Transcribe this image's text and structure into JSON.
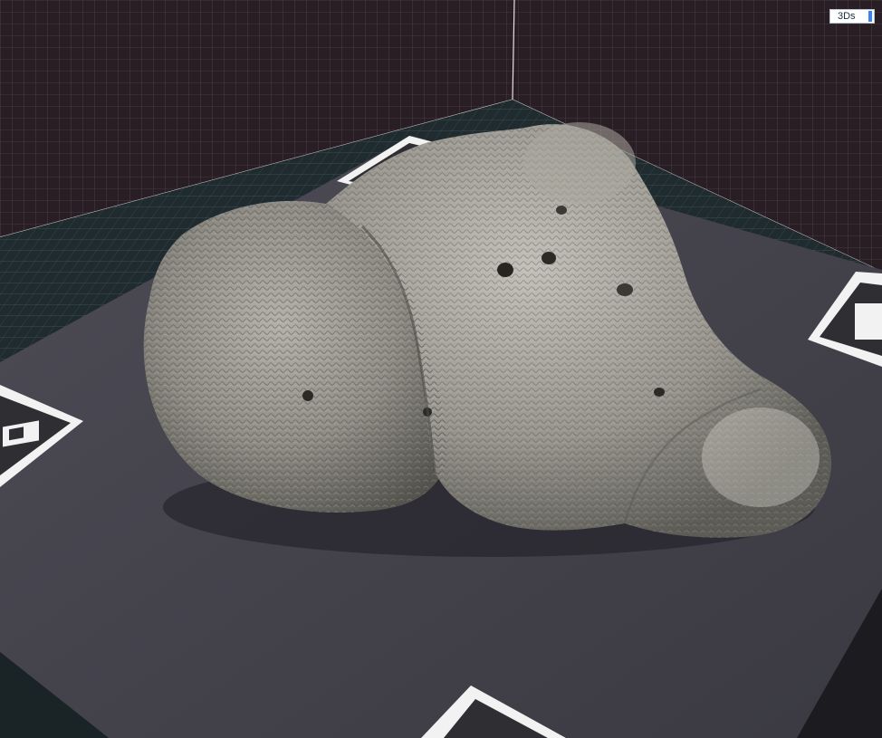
{
  "viewer": {
    "mode_label": "3Ds"
  },
  "scene": {
    "background_color": "#2a1e25",
    "grid_color": "#8a7a85",
    "floor_grid_color": "#4f6266",
    "board_color": "#45434d",
    "specimen_color": "#8e8c84"
  }
}
